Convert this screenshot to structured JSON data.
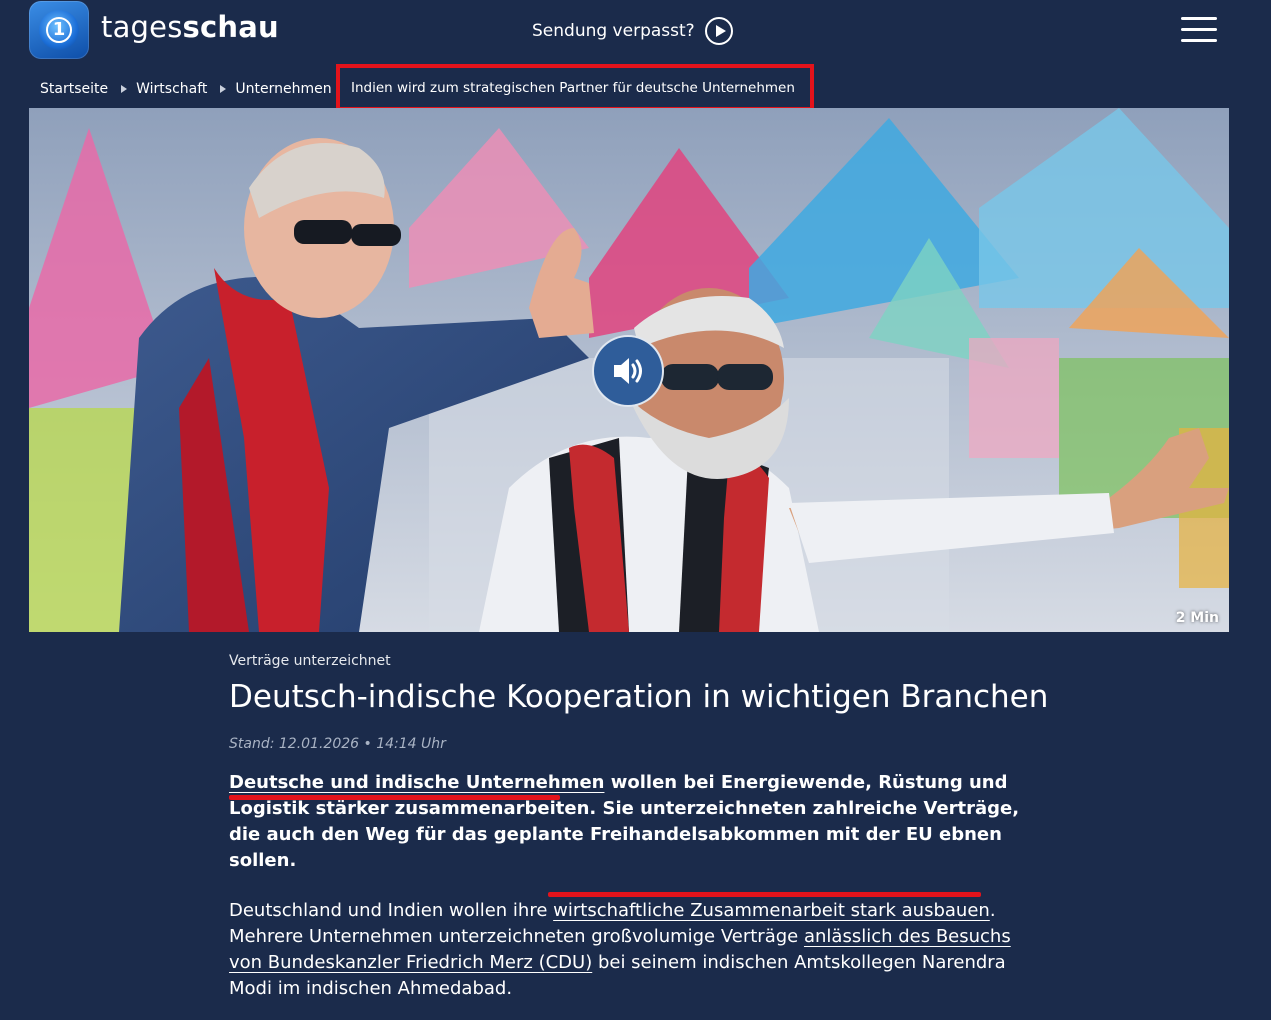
{
  "header": {
    "logo_text_light": "tages",
    "logo_text_bold": "schau",
    "sendung_label": "Sendung verpasst?"
  },
  "breadcrumb": {
    "items": [
      "Startseite",
      "Wirtschaft",
      "Unternehmen"
    ],
    "current": "Indien wird zum strategischen Partner für deutsche Unternehmen"
  },
  "hero": {
    "duration": "2 Min"
  },
  "article": {
    "kicker": "Verträge unterzeichnet",
    "headline": "Deutsch-indische Kooperation in wichtigen Branchen",
    "stand": "Stand: 12.01.2026 • 14:14 Uhr",
    "lead_link": "Deutsche und indische Unternehmen",
    "lead_rest": " wollen bei Energiewende, Rüstung und Logistik stärker zusammenarbeiten. Sie unterzeichneten zahlreiche Verträge, die auch den Weg für das geplante Freihandelsabkommen mit der EU ebnen sollen.",
    "body_1": "Deutschland und Indien wollen ihre ",
    "body_link_1": "wirtschaftliche Zusammenarbeit stark ausbauen",
    "body_2": ". Mehrere Unternehmen unterzeichneten großvolumige Verträge ",
    "body_link_2": "anlässlich des Besuchs von Bundeskanzler Friedrich Merz (CDU)",
    "body_3": " bei seinem indischen Amtskollegen Narendra Modi im indischen Ahmedabad."
  },
  "colors": {
    "background": "#1b2b4b",
    "highlight_red": "#e3131b",
    "sound_button": "#2f5d9a"
  },
  "icons": [
    "tagesschau-logo-icon",
    "play-icon",
    "menu-icon",
    "breadcrumb-arrow-icon",
    "speaker-icon"
  ]
}
